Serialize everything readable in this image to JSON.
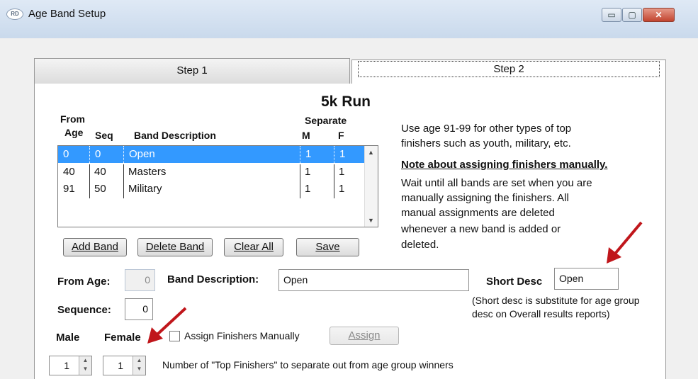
{
  "window": {
    "title": "Age Band Setup",
    "icon": "app-logo-icon"
  },
  "controls": {
    "minimize": "▭",
    "maximize": "▢",
    "close": "✕"
  },
  "tabs": [
    {
      "label": "Step 1"
    },
    {
      "label": "Step 2"
    }
  ],
  "event_title": "5k Run",
  "list_headers": {
    "from": "From",
    "age": "Age",
    "seq": "Seq",
    "band_description": "Band Description",
    "separate": "Separate",
    "m": "M",
    "f": "F"
  },
  "bands": [
    {
      "age": "0",
      "seq": "0",
      "description": "Open",
      "m": "1",
      "f": "1",
      "selected": true
    },
    {
      "age": "40",
      "seq": "40",
      "description": "Masters",
      "m": "1",
      "f": "1",
      "selected": false
    },
    {
      "age": "91",
      "seq": "50",
      "description": "Military",
      "m": "1",
      "f": "1",
      "selected": false
    }
  ],
  "buttons": {
    "add_band": "Add Band",
    "delete_band": "Delete Band",
    "clear_all": "Clear All",
    "save": "Save",
    "assign": "Assign"
  },
  "info": {
    "line1": "Use age 91-99 for other types of top",
    "line2": "finishers such as youth, military, etc.",
    "note_heading": "Note about assigning finishers manually.",
    "note1": "Wait until all bands are set when you are",
    "note2": "manually assigning the finishers.  All",
    "note3": "manual assignments are deleted",
    "note4": "whenever a new band is added or",
    "note5": "deleted."
  },
  "form": {
    "from_age_label": "From Age:",
    "from_age_value": "0",
    "band_description_label": "Band Description:",
    "band_description_value": "Open",
    "short_desc_label": "Short Desc",
    "short_desc_value": "Open",
    "short_desc_hint1": "(Short desc is substitute for age group",
    "short_desc_hint2": "desc on Overall results reports)",
    "sequence_label": "Sequence:",
    "sequence_value": "0",
    "male_label": "Male",
    "female_label": "Female",
    "assign_manually_label": "Assign Finishers Manually",
    "male_top": "1",
    "female_top": "1",
    "top_finishers_label": "Number of \"Top Finishers\" to separate out from age group winners"
  },
  "colors": {
    "selection": "#3399ff",
    "annotation_arrow": "#c0161b"
  }
}
